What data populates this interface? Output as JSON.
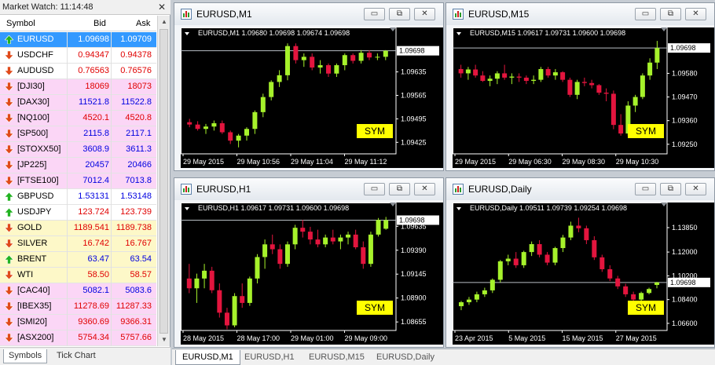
{
  "market_watch": {
    "title": "Market Watch: 11:14:48",
    "close": "✕",
    "columns": {
      "symbol": "Symbol",
      "bid": "Bid",
      "ask": "Ask"
    },
    "rows": [
      {
        "symbol": "EURUSD",
        "bid": "1.09698",
        "ask": "1.09709",
        "dir": "up",
        "bg": "sel",
        "color": "b"
      },
      {
        "symbol": "USDCHF",
        "bid": "0.94347",
        "ask": "0.94378",
        "dir": "down",
        "bg": "white",
        "color": "r"
      },
      {
        "symbol": "AUDUSD",
        "bid": "0.76563",
        "ask": "0.76576",
        "dir": "down",
        "bg": "white",
        "color": "r"
      },
      {
        "symbol": "[DJI30]",
        "bid": "18069",
        "ask": "18073",
        "dir": "down",
        "bg": "pink",
        "color": "r"
      },
      {
        "symbol": "[DAX30]",
        "bid": "11521.8",
        "ask": "11522.8",
        "dir": "down",
        "bg": "pink",
        "color": "b"
      },
      {
        "symbol": "[NQ100]",
        "bid": "4520.1",
        "ask": "4520.8",
        "dir": "down",
        "bg": "pink",
        "color": "r"
      },
      {
        "symbol": "[SP500]",
        "bid": "2115.8",
        "ask": "2117.1",
        "dir": "down",
        "bg": "pink",
        "color": "b"
      },
      {
        "symbol": "[STOXX50]",
        "bid": "3608.9",
        "ask": "3611.3",
        "dir": "down",
        "bg": "pink",
        "color": "b"
      },
      {
        "symbol": "[JP225]",
        "bid": "20457",
        "ask": "20466",
        "dir": "down",
        "bg": "pink",
        "color": "b"
      },
      {
        "symbol": "[FTSE100]",
        "bid": "7012.4",
        "ask": "7013.8",
        "dir": "down",
        "bg": "pink",
        "color": "b"
      },
      {
        "symbol": "GBPUSD",
        "bid": "1.53131",
        "ask": "1.53148",
        "dir": "up",
        "bg": "white",
        "color": "b"
      },
      {
        "symbol": "USDJPY",
        "bid": "123.724",
        "ask": "123.739",
        "dir": "up",
        "bg": "white",
        "color": "r"
      },
      {
        "symbol": "GOLD",
        "bid": "1189.541",
        "ask": "1189.738",
        "dir": "down",
        "bg": "yellow",
        "color": "r"
      },
      {
        "symbol": "SILVER",
        "bid": "16.742",
        "ask": "16.767",
        "dir": "down",
        "bg": "yellow",
        "color": "r"
      },
      {
        "symbol": "BRENT",
        "bid": "63.47",
        "ask": "63.54",
        "dir": "up",
        "bg": "yellow",
        "color": "b"
      },
      {
        "symbol": "WTI",
        "bid": "58.50",
        "ask": "58.57",
        "dir": "down",
        "bg": "yellow",
        "color": "r"
      },
      {
        "symbol": "[CAC40]",
        "bid": "5082.1",
        "ask": "5083.6",
        "dir": "down",
        "bg": "pink",
        "color": "b"
      },
      {
        "symbol": "[IBEX35]",
        "bid": "11278.69",
        "ask": "11287.33",
        "dir": "down",
        "bg": "pink",
        "color": "r"
      },
      {
        "symbol": "[SMI20]",
        "bid": "9360.69",
        "ask": "9366.31",
        "dir": "down",
        "bg": "pink",
        "color": "r"
      },
      {
        "symbol": "[ASX200]",
        "bid": "5754.34",
        "ask": "5757.66",
        "dir": "down",
        "bg": "pink",
        "color": "r"
      }
    ],
    "tabs": [
      "Symbols",
      "Tick Chart"
    ]
  },
  "colors": {
    "up": "#a6f22b",
    "down": "#e3153e",
    "bg": "#000000",
    "grid": "#3a3f45",
    "axis": "#ffffff",
    "bid_line": "#b8bec4",
    "badge": "#ffff00"
  },
  "window_buttons": {
    "minimize": "▭",
    "restore": "⧉",
    "close": "✕"
  },
  "charts": [
    {
      "window_title": "EURUSD,M1",
      "legend": "EURUSD,M1  1.09680 1.09698 1.09674 1.09698",
      "badge": "SYM",
      "price_label": "1.09698",
      "y_ticks": [
        "1.09635",
        "1.09565",
        "1.09495",
        "1.09425"
      ],
      "x_ticks": [
        "29 May 2015",
        "29 May 10:56",
        "29 May 11:04",
        "29 May 11:12"
      ],
      "chart_data": {
        "type": "candlestick",
        "ylim": [
          1.094,
          1.0973
        ],
        "current": 1.09698,
        "y_tick_values": [
          1.09635,
          1.09565,
          1.09495,
          1.09425
        ],
        "candles": [
          [
            1.09485,
            1.09495,
            1.0947,
            1.09478
          ],
          [
            1.09478,
            1.09488,
            1.0946,
            1.09465
          ],
          [
            1.09465,
            1.0948,
            1.0945,
            1.09472
          ],
          [
            1.09472,
            1.0949,
            1.0946,
            1.09482
          ],
          [
            1.09482,
            1.0949,
            1.0945,
            1.09455
          ],
          [
            1.09455,
            1.0946,
            1.0942,
            1.0943
          ],
          [
            1.0943,
            1.0945,
            1.0941,
            1.09445
          ],
          [
            1.09445,
            1.0947,
            1.0943,
            1.09465
          ],
          [
            1.09465,
            1.0952,
            1.0945,
            1.09515
          ],
          [
            1.09515,
            1.0957,
            1.095,
            1.0956
          ],
          [
            1.0956,
            1.0961,
            1.0955,
            1.09605
          ],
          [
            1.09605,
            1.0964,
            1.0959,
            1.09625
          ],
          [
            1.09625,
            1.0972,
            1.0961,
            1.09712
          ],
          [
            1.09712,
            1.0972,
            1.0966,
            1.0967
          ],
          [
            1.0967,
            1.0969,
            1.0965,
            1.0968
          ],
          [
            1.0968,
            1.0969,
            1.0964,
            1.09648
          ],
          [
            1.09648,
            1.0967,
            1.0963,
            1.09655
          ],
          [
            1.09655,
            1.0966,
            1.0962,
            1.0963
          ],
          [
            1.0963,
            1.0966,
            1.0962,
            1.09655
          ],
          [
            1.09655,
            1.0969,
            1.0964,
            1.09685
          ],
          [
            1.09685,
            1.0969,
            1.0966,
            1.09668
          ],
          [
            1.09668,
            1.097,
            1.0966,
            1.09692
          ],
          [
            1.09692,
            1.097,
            1.0967,
            1.09678
          ],
          [
            1.09678,
            1.0969,
            1.0967,
            1.0968
          ],
          [
            1.0968,
            1.097,
            1.0967,
            1.09698
          ]
        ]
      }
    },
    {
      "window_title": "EURUSD,M15",
      "legend": "EURUSD,M15  1.09617 1.09731 1.09600 1.09698",
      "badge": "SYM",
      "price_label": "1.09698",
      "y_ticks": [
        "1.09580",
        "1.09470",
        "1.09360",
        "1.09250"
      ],
      "x_ticks": [
        "29 May 2015",
        "29 May 06:30",
        "29 May 08:30",
        "29 May 10:30"
      ],
      "chart_data": {
        "type": "candlestick",
        "ylim": [
          1.0922,
          1.09735
        ],
        "current": 1.09698,
        "y_tick_values": [
          1.0958,
          1.0947,
          1.0936,
          1.0925
        ],
        "candles": [
          [
            1.096,
            1.0962,
            1.0956,
            1.0958
          ],
          [
            1.0958,
            1.0961,
            1.0955,
            1.09598
          ],
          [
            1.09598,
            1.0962,
            1.0956,
            1.0957
          ],
          [
            1.0957,
            1.0959,
            1.0954,
            1.09545
          ],
          [
            1.09545,
            1.0957,
            1.0952,
            1.09555
          ],
          [
            1.09555,
            1.0959,
            1.0953,
            1.0958
          ],
          [
            1.0958,
            1.0962,
            1.0955,
            1.0956
          ],
          [
            1.0956,
            1.0958,
            1.0953,
            1.09565
          ],
          [
            1.09565,
            1.0958,
            1.0954,
            1.0956
          ],
          [
            1.0956,
            1.0957,
            1.0953,
            1.09545
          ],
          [
            1.09545,
            1.0957,
            1.0953,
            1.0955
          ],
          [
            1.0955,
            1.0961,
            1.0954,
            1.096
          ],
          [
            1.096,
            1.0961,
            1.0956,
            1.0957
          ],
          [
            1.0957,
            1.096,
            1.0955,
            1.09585
          ],
          [
            1.09585,
            1.0959,
            1.0954,
            1.0955
          ],
          [
            1.0955,
            1.0956,
            1.0947,
            1.0948
          ],
          [
            1.0948,
            1.0955,
            1.0946,
            1.0954
          ],
          [
            1.0954,
            1.0956,
            1.0952,
            1.09535
          ],
          [
            1.09535,
            1.0955,
            1.0951,
            1.09525
          ],
          [
            1.09525,
            1.0953,
            1.0948,
            1.0949
          ],
          [
            1.0949,
            1.0951,
            1.0945,
            1.09485
          ],
          [
            1.09485,
            1.095,
            1.0932,
            1.0934
          ],
          [
            1.0934,
            1.0939,
            1.0929,
            1.093
          ],
          [
            1.093,
            1.0945,
            1.0929,
            1.0943
          ],
          [
            1.0943,
            1.0948,
            1.094,
            1.0947
          ],
          [
            1.0947,
            1.0958,
            1.0946,
            1.0957
          ],
          [
            1.0957,
            1.0965,
            1.0955,
            1.0963
          ],
          [
            1.0963,
            1.09731,
            1.096,
            1.09698
          ]
        ]
      }
    },
    {
      "window_title": "EURUSD,H1",
      "legend": "EURUSD,H1  1.09617 1.09731 1.09600 1.09698",
      "badge": "SYM",
      "price_label": "1.09698",
      "y_ticks": [
        "1.09635",
        "1.09390",
        "1.09145",
        "1.08900",
        "1.08655"
      ],
      "x_ticks": [
        "28 May 2015",
        "28 May 17:00",
        "29 May 01:00",
        "29 May 09:00"
      ],
      "chart_data": {
        "type": "candlestick",
        "ylim": [
          1.086,
          1.0975
        ],
        "current": 1.09698,
        "y_tick_values": [
          1.09635,
          1.0939,
          1.09145,
          1.089,
          1.08655
        ],
        "candles": [
          [
            1.091,
            1.0925,
            1.0895,
            1.09
          ],
          [
            1.09,
            1.0915,
            1.0885,
            1.091
          ],
          [
            1.091,
            1.0925,
            1.09,
            1.0918
          ],
          [
            1.0918,
            1.0922,
            1.0895,
            1.0898
          ],
          [
            1.0898,
            1.0905,
            1.087,
            1.0875
          ],
          [
            1.0875,
            1.088,
            1.0858,
            1.0862
          ],
          [
            1.0862,
            1.0895,
            1.086,
            1.0892
          ],
          [
            1.0892,
            1.0905,
            1.088,
            1.0885
          ],
          [
            1.0885,
            1.0912,
            1.0882,
            1.091
          ],
          [
            1.091,
            1.0935,
            1.0905,
            1.0932
          ],
          [
            1.0932,
            1.095,
            1.092,
            1.0945
          ],
          [
            1.0945,
            1.0955,
            1.0935,
            1.094
          ],
          [
            1.094,
            1.0945,
            1.092,
            1.0925
          ],
          [
            1.0925,
            1.0948,
            1.0922,
            1.0945
          ],
          [
            1.0945,
            1.0965,
            1.094,
            1.0962
          ],
          [
            1.0962,
            1.097,
            1.0952,
            1.0958
          ],
          [
            1.0958,
            1.0963,
            1.0945,
            1.095
          ],
          [
            1.095,
            1.096,
            1.0942,
            1.0945
          ],
          [
            1.0945,
            1.0955,
            1.0942,
            1.0952
          ],
          [
            1.0952,
            1.096,
            1.0945,
            1.0948
          ],
          [
            1.0948,
            1.0955,
            1.094,
            1.0952
          ],
          [
            1.0952,
            1.0958,
            1.0945,
            1.0955
          ],
          [
            1.0955,
            1.096,
            1.094,
            1.0942
          ],
          [
            1.0942,
            1.0948,
            1.092,
            1.0925
          ],
          [
            1.0925,
            1.0958,
            1.0922,
            1.0955
          ],
          [
            1.0955,
            1.0972,
            1.0953,
            1.097
          ],
          [
            1.0961,
            1.09731,
            1.096,
            1.09698
          ]
        ]
      }
    },
    {
      "window_title": "EURUSD,Daily",
      "legend": "EURUSD,Daily  1.09511 1.09739 1.09254 1.09698",
      "badge": "SYM",
      "price_label": "1.09698",
      "y_ticks": [
        "1.13850",
        "1.12000",
        "1.10200",
        "1.08400",
        "1.06600"
      ],
      "x_ticks": [
        "23 Apr 2015",
        "5 May 2015",
        "15 May 2015",
        "27 May 2015"
      ],
      "chart_data": {
        "type": "candlestick",
        "ylim": [
          1.063,
          1.148
        ],
        "current": 1.09698,
        "y_tick_values": [
          1.1385,
          1.12,
          1.102,
          1.084,
          1.066
        ],
        "candles": [
          [
            1.079,
            1.083,
            1.076,
            1.082
          ],
          [
            1.082,
            1.086,
            1.08,
            1.084
          ],
          [
            1.084,
            1.09,
            1.082,
            1.088
          ],
          [
            1.088,
            1.093,
            1.086,
            1.091
          ],
          [
            1.091,
            1.1,
            1.089,
            1.099
          ],
          [
            1.099,
            1.114,
            1.097,
            1.113
          ],
          [
            1.113,
            1.118,
            1.11,
            1.115
          ],
          [
            1.115,
            1.12,
            1.108,
            1.11
          ],
          [
            1.11,
            1.121,
            1.108,
            1.12
          ],
          [
            1.12,
            1.128,
            1.117,
            1.126
          ],
          [
            1.126,
            1.129,
            1.116,
            1.118
          ],
          [
            1.118,
            1.12,
            1.11,
            1.112
          ],
          [
            1.112,
            1.124,
            1.11,
            1.123
          ],
          [
            1.123,
            1.133,
            1.12,
            1.131
          ],
          [
            1.131,
            1.143,
            1.129,
            1.14
          ],
          [
            1.14,
            1.146,
            1.135,
            1.138
          ],
          [
            1.138,
            1.14,
            1.126,
            1.129
          ],
          [
            1.129,
            1.132,
            1.114,
            1.116
          ],
          [
            1.116,
            1.118,
            1.105,
            1.107
          ],
          [
            1.107,
            1.11,
            1.098,
            1.1
          ],
          [
            1.1,
            1.102,
            1.092,
            1.094
          ],
          [
            1.094,
            1.096,
            1.086,
            1.088
          ],
          [
            1.088,
            1.09,
            1.081,
            1.084
          ],
          [
            1.084,
            1.09,
            1.083,
            1.089
          ],
          [
            1.089,
            1.093,
            1.088,
            1.092
          ],
          [
            1.09511,
            1.09739,
            1.09254,
            1.09698
          ]
        ]
      }
    }
  ],
  "bottom_tabs": [
    {
      "label": "EURUSD,M1",
      "active": true
    },
    {
      "label": "EURUSD,H1",
      "active": false
    },
    {
      "label": "EURUSD,M15",
      "active": false
    },
    {
      "label": "EURUSD,Daily",
      "active": false
    }
  ]
}
